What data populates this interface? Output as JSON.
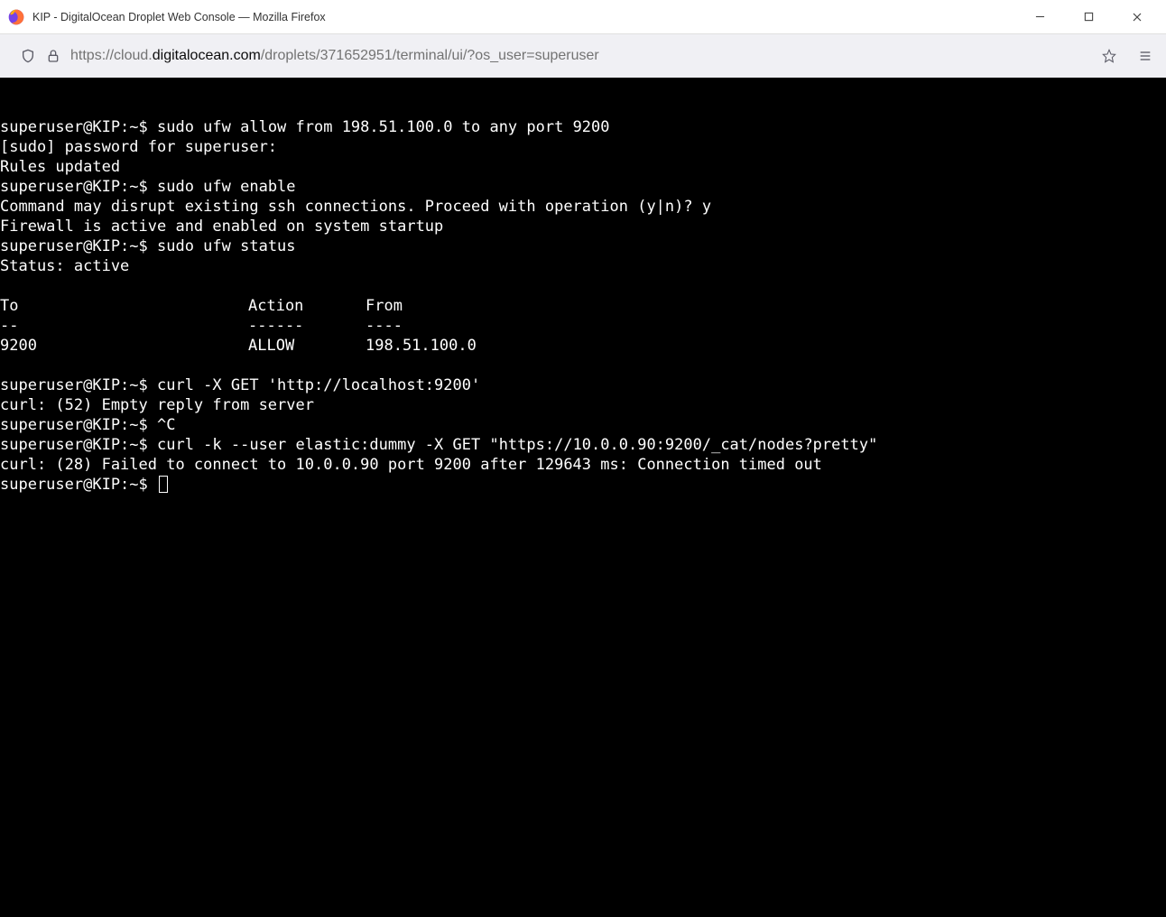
{
  "window": {
    "title": "KIP - DigitalOcean Droplet Web Console — Mozilla Firefox"
  },
  "url": {
    "scheme": "https://",
    "sub": "cloud.",
    "host": "digitalocean.com",
    "path": "/droplets/371652951/terminal/ui/?os_user=superuser"
  },
  "terminal": {
    "prompt": "superuser@KIP:~$ ",
    "lines": [
      {
        "prompt": true,
        "text": "sudo ufw allow from 198.51.100.0 to any port 9200"
      },
      {
        "prompt": false,
        "text": "[sudo] password for superuser:"
      },
      {
        "prompt": false,
        "text": "Rules updated"
      },
      {
        "prompt": true,
        "text": "sudo ufw enable"
      },
      {
        "prompt": false,
        "text": "Command may disrupt existing ssh connections. Proceed with operation (y|n)? y"
      },
      {
        "prompt": false,
        "text": "Firewall is active and enabled on system startup"
      },
      {
        "prompt": true,
        "text": "sudo ufw status"
      },
      {
        "prompt": false,
        "text": "Status: active"
      },
      {
        "prompt": false,
        "text": ""
      }
    ],
    "status_table": {
      "headers": {
        "to": "To",
        "action": "Action",
        "from": "From"
      },
      "dividers": {
        "to": "--",
        "action": "------",
        "from": "----"
      },
      "rows": [
        {
          "to": "9200",
          "action": "ALLOW",
          "from": "198.51.100.0"
        }
      ]
    },
    "lines2": [
      {
        "prompt": false,
        "text": ""
      },
      {
        "prompt": true,
        "text": "curl -X GET 'http://localhost:9200'"
      },
      {
        "prompt": false,
        "text": "curl: (52) Empty reply from server"
      },
      {
        "prompt": true,
        "text": "^C"
      },
      {
        "prompt": true,
        "text": "curl -k --user elastic:dummy -X GET \"https://10.0.0.90:9200/_cat/nodes?pretty\""
      },
      {
        "prompt": false,
        "text": "curl: (28) Failed to connect to 10.0.0.90 port 9200 after 129643 ms: Connection timed out"
      }
    ],
    "final_prompt": "superuser@KIP:~$ "
  }
}
